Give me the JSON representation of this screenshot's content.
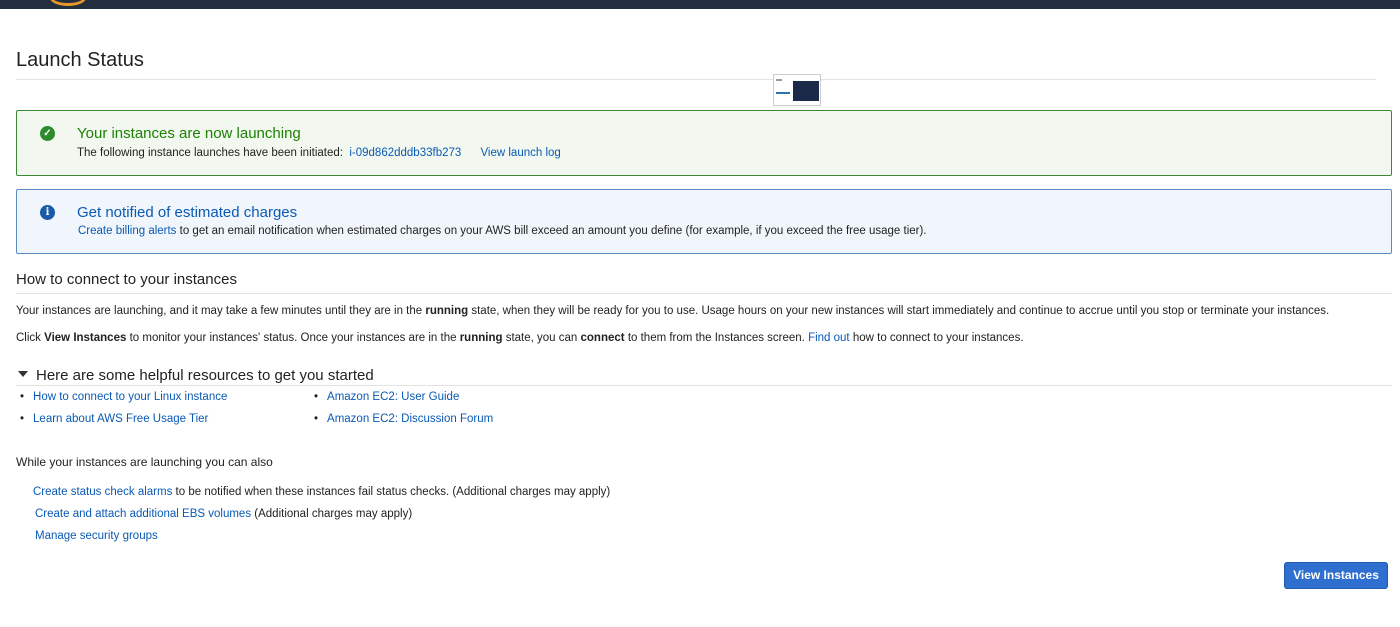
{
  "page": {
    "title": "Launch Status"
  },
  "success_alert": {
    "title": "Your instances are now launching",
    "body_prefix": "The following instance launches have been initiated:",
    "instance_id": "i-09d862dddb33fb273",
    "view_log": "View launch log"
  },
  "info_alert": {
    "title": "Get notified of estimated charges",
    "link": "Create billing alerts",
    "body": "to get an email notification when estimated charges on your AWS bill exceed an amount you define (for example, if you exceed the free usage tier)."
  },
  "connect": {
    "title": "How to connect to your instances",
    "p1_a": "Your instances are launching, and it may take a few minutes until they are in the",
    "p1_bold": "running",
    "p1_b": "state, when they will be ready for you to use. Usage hours on your new instances will start immediately and continue to accrue until you stop or terminate your instances.",
    "p2_a": "Click",
    "p2_bold1": "View Instances",
    "p2_b": "to monitor your instances' status. Once your instances are in the",
    "p2_bold2": "running",
    "p2_c": "state, you can",
    "p2_bold3": "connect",
    "p2_d": "to them from the Instances screen.",
    "p2_link": "Find out",
    "p2_e": "how to connect to your instances."
  },
  "resources": {
    "title": "Here are some helpful resources to get you started",
    "items": [
      "How to connect to your Linux instance",
      "Learn about AWS Free Usage Tier",
      "Amazon EC2: User Guide",
      "Amazon EC2: Discussion Forum"
    ]
  },
  "also": {
    "title": "While your instances are launching you can also",
    "items": [
      {
        "link": "Create status check alarms",
        "text": "to be notified when these instances fail status checks. (Additional charges may apply)"
      },
      {
        "link": "Create and attach additional EBS volumes",
        "text": "(Additional charges may apply)"
      },
      {
        "link": "Manage security groups",
        "text": ""
      }
    ]
  },
  "buttons": {
    "view_instances": "View Instances"
  },
  "icons": {
    "success": "check-circle-icon",
    "info": "info-circle-icon",
    "caret": "caret-down-icon"
  },
  "colors": {
    "success": "#1d8102",
    "link": "#0a5ab4",
    "primary_button": "#2e6fd0",
    "topbar": "#232f3e"
  }
}
